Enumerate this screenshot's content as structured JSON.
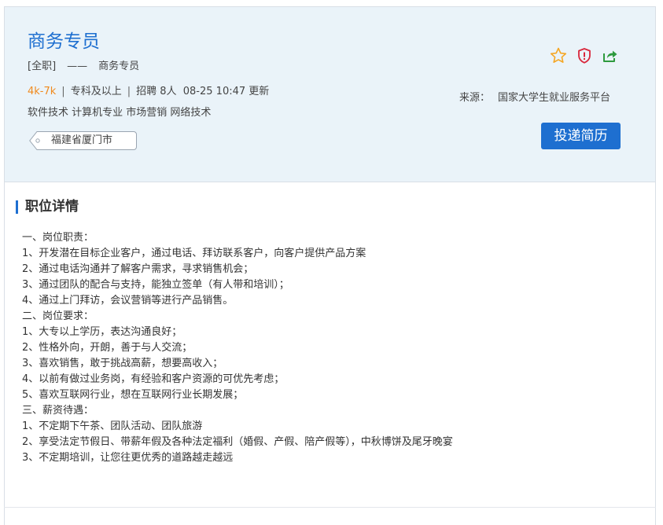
{
  "job": {
    "title": "商务专员",
    "type": "[全职]",
    "dash": "——",
    "category": "商务专员",
    "salary": "4k-7k",
    "education": "专科及以上",
    "recruit": "招聘 8人",
    "updated": "08-25 10:47 更新",
    "majors": "软件技术 计算机专业 市场营销 网络技术",
    "location": "福建省厦门市"
  },
  "actions": {
    "favorite_icon": "star-icon",
    "report_icon": "shield-alert-icon",
    "share_icon": "share-icon",
    "apply_label": "投递简历"
  },
  "source": {
    "label": "来源：",
    "value": "国家大学生就业服务平台"
  },
  "section": {
    "title": "职位详情"
  },
  "details": [
    "一、岗位职责：",
    "1、开发潜在目标企业客户，通过电话、拜访联系客户，向客户提供产品方案",
    "2、通过电话沟通并了解客户需求，寻求销售机会；",
    "3、通过团队的配合与支持，能独立签单（有人带和培训）；",
    "4、通过上门拜访，会议营销等进行产品销售。",
    "二、岗位要求：",
    "1、大专以上学历，表达沟通良好；",
    "2、性格外向，开朗，善于与人交流；",
    "3、喜欢销售，敢于挑战高薪，想要高收入；",
    "4、以前有做过业务岗，有经验和客户资源的可优先考虑；",
    "5、喜欢互联网行业，想在互联网行业长期发展；",
    "三、薪资待遇：",
    "1、不定期下午茶、团队活动、团队旅游",
    "2、享受法定节假日、带薪年假及各种法定福利（婚假、产假、陪产假等），中秋博饼及尾牙晚宴",
    "3、不定期培训，让您往更优秀的道路越走越远"
  ],
  "colors": {
    "accent": "#1e6fd0",
    "salary": "#f08a1d",
    "header_bg": "#eaf3f9",
    "star": "#f5a623",
    "report": "#d9263b",
    "share": "#2e9a3e"
  }
}
